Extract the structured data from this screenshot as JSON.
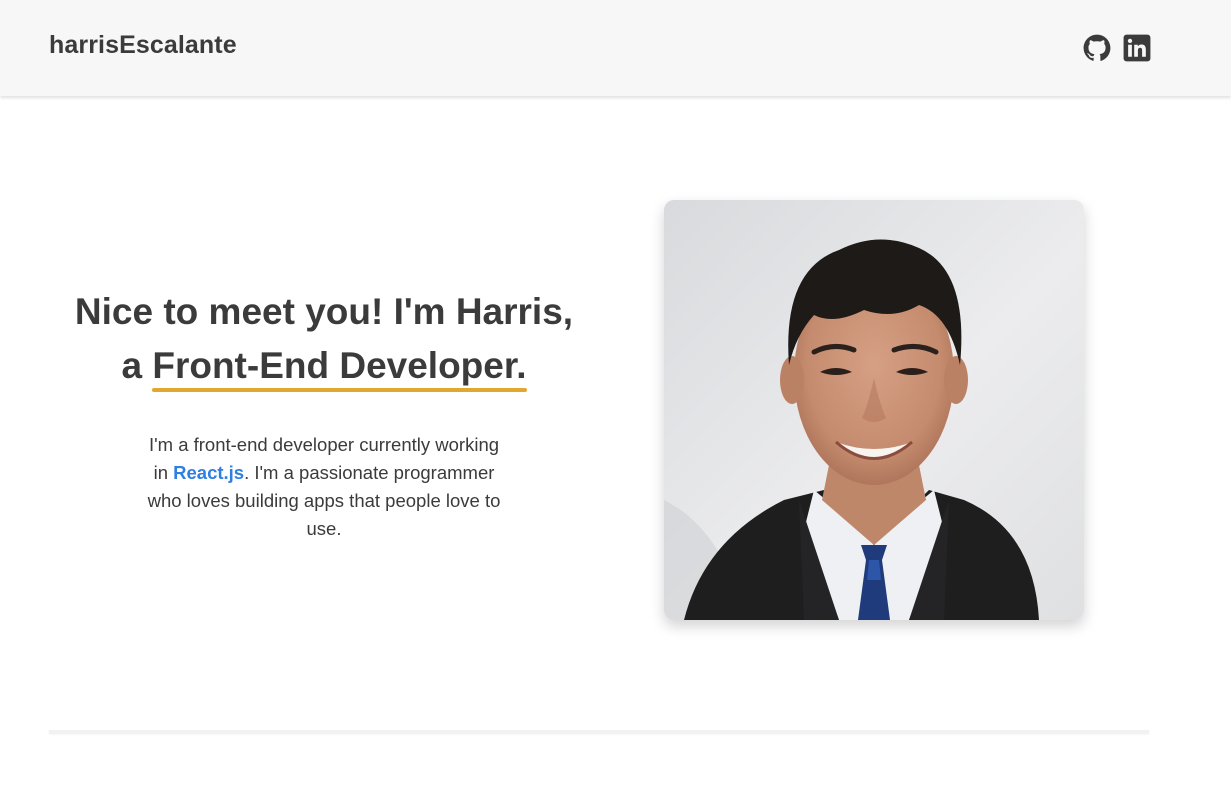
{
  "nav": {
    "brand": "harrisEscalante",
    "social": [
      {
        "icon": "github-icon"
      },
      {
        "icon": "linkedin-icon"
      }
    ]
  },
  "hero": {
    "headline_part1": "Nice to meet you! I'm Harris,",
    "headline_part2_prefix": "a ",
    "headline_role": "Front-End Developer.",
    "intro_before": "I'm a front-end developer currently working in ",
    "intro_tech": "React.js",
    "intro_after": ". I'm a passionate programmer who loves building apps that people love to use."
  },
  "colors": {
    "accent_underline": "#e0a82e",
    "link_blue": "#2f7fe3",
    "nav_background": "#f7f7f7",
    "text": "#3b3b3b"
  }
}
